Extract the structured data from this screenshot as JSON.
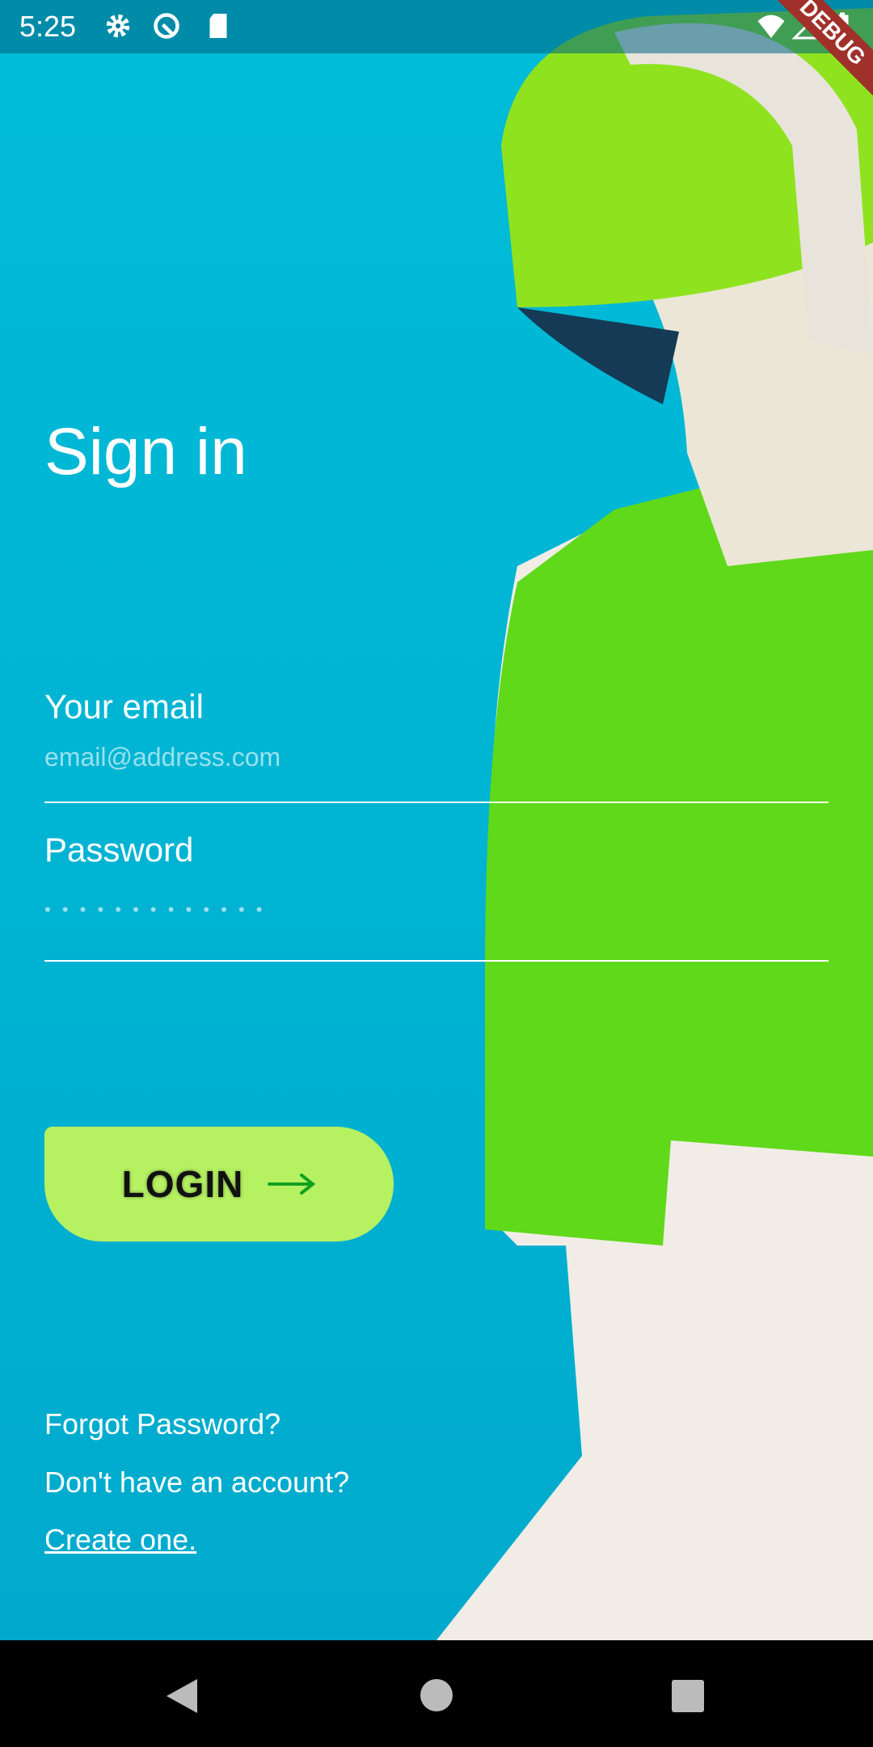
{
  "status_bar": {
    "time": "5:25",
    "icons": [
      "gear-icon",
      "at-sign-icon",
      "sd-card-icon",
      "wifi-icon",
      "signal-icon",
      "battery-icon"
    ],
    "debug_banner": "DEBUG"
  },
  "title": "Sign in",
  "email": {
    "label": "Your email",
    "placeholder": "email@address.com"
  },
  "password": {
    "label": "Password",
    "placeholder": "• • • • • • • • • • • • •"
  },
  "login_button": {
    "label": "LOGIN",
    "icon": "arrow-right-icon"
  },
  "links": {
    "forgot": "Forgot Password?",
    "no_account": "Don't have an account?",
    "create": "Create one."
  },
  "colors": {
    "background": "#00b4d4",
    "button": "#b6f162",
    "arrow": "#12a020"
  }
}
